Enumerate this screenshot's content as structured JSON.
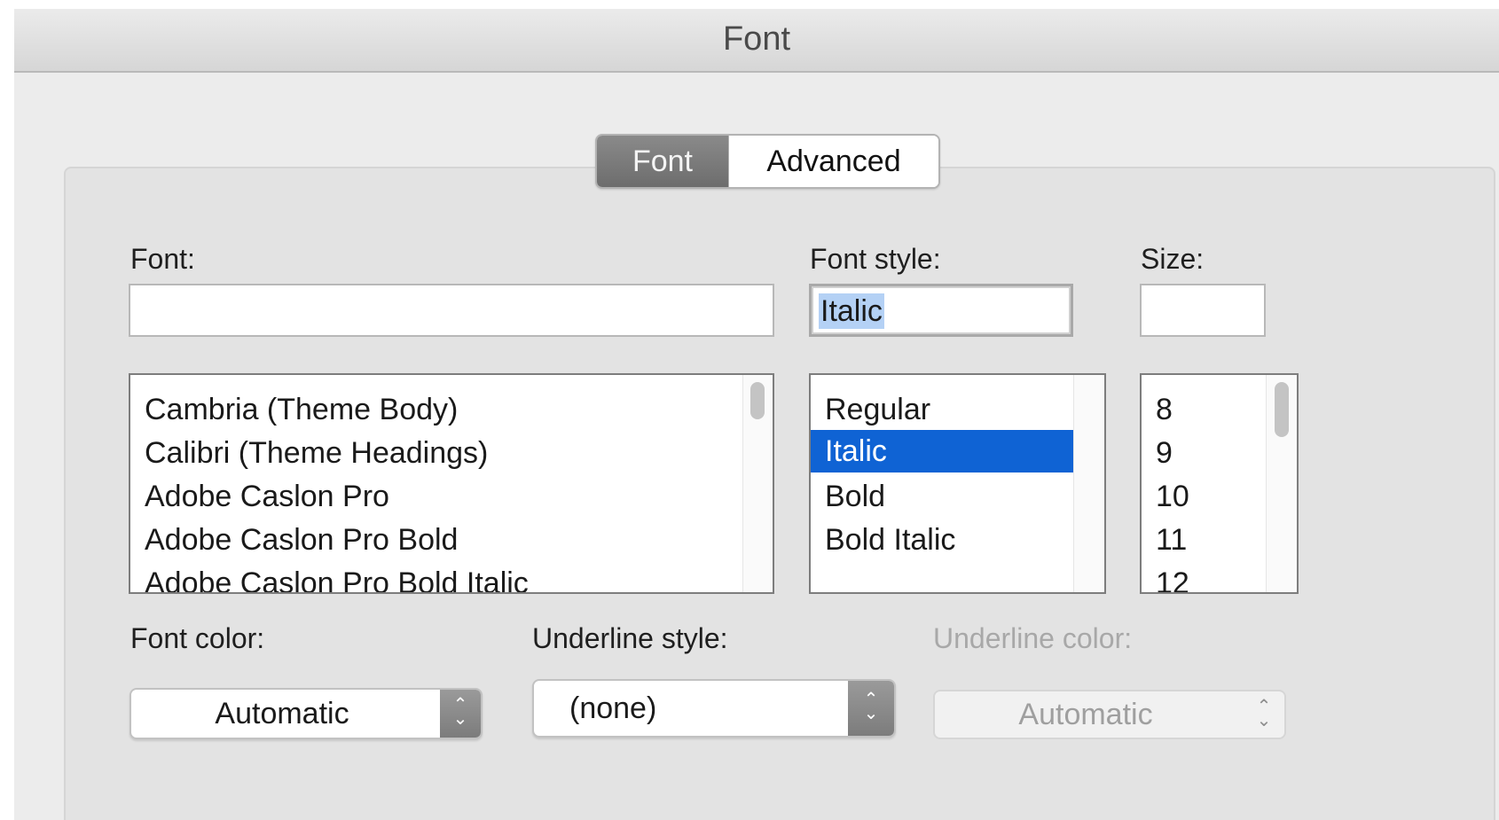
{
  "window": {
    "title": "Font"
  },
  "tabs": [
    {
      "label": "Font",
      "selected": true
    },
    {
      "label": "Advanced",
      "selected": false
    }
  ],
  "font_field": {
    "label": "Font:",
    "value": ""
  },
  "style_field": {
    "label": "Font style:",
    "value": "Italic"
  },
  "size_field": {
    "label": "Size:",
    "value": ""
  },
  "font_list": {
    "items": [
      "Cambria (Theme Body)",
      "Calibri (Theme Headings)",
      "Adobe Caslon Pro",
      "Adobe Caslon Pro Bold",
      "Adobe Caslon Pro Bold Italic"
    ]
  },
  "style_list": {
    "items": [
      "Regular",
      "Italic",
      "Bold",
      "Bold Italic"
    ],
    "selected": "Italic"
  },
  "size_list": {
    "items": [
      "8",
      "9",
      "10",
      "11",
      "12"
    ]
  },
  "font_color": {
    "label": "Font color:",
    "value": "Automatic"
  },
  "underline_style": {
    "label": "Underline style:",
    "value": "(none)"
  },
  "underline_color": {
    "label": "Underline color:",
    "value": "Automatic",
    "disabled": true
  },
  "colors": {
    "selection": "#0f63d4",
    "text_highlight": "#b4d1f5",
    "window_bg": "#ececec"
  }
}
